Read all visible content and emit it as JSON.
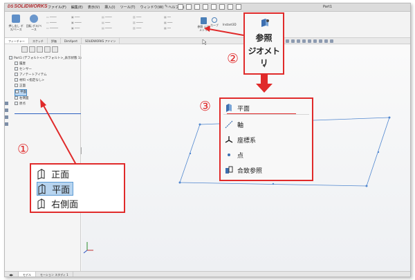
{
  "app": {
    "logo_text": "SOLIDWORKS",
    "logo_mark": "DS",
    "document_title": "Part1",
    "menus": [
      "ファイル(F)",
      "編集(E)",
      "表示(V)",
      "挿入(I)",
      "ツール(T)",
      "ウィンドウ(W)",
      "ヘルプ(H)"
    ]
  },
  "command_manager": {
    "buttons": [
      {
        "label": "押し出し ボス/ベース",
        "icon": "extruded-boss-icon"
      },
      {
        "label": "回転 ボス/ベース",
        "icon": "revolved-boss-icon"
      }
    ],
    "reference_geometry_small_label": "参照 ジオメトリ",
    "curves_label": "カーブ",
    "instant3d_label": "Instant3D",
    "tabs": [
      "フィーチャー",
      "スケッチ",
      "評価",
      "DimXpert",
      "SOLIDWORKS アドイン"
    ]
  },
  "feature_manager": {
    "tree": [
      {
        "label": "Part1 (デフォルト<<デフォルト>_表示状態 1>)",
        "icon": "part-icon"
      },
      {
        "label": "履歴",
        "icon": "history-icon"
      },
      {
        "label": "センサー",
        "icon": "sensor-icon"
      },
      {
        "label": "アノテートアイテム",
        "icon": "annotation-icon"
      },
      {
        "label": "材料 <指定なし>",
        "icon": "material-icon"
      },
      {
        "label": "正面",
        "icon": "plane-icon"
      },
      {
        "label": "平面",
        "icon": "plane-icon"
      },
      {
        "label": "右側面",
        "icon": "plane-icon"
      },
      {
        "label": "原点",
        "icon": "origin-icon"
      }
    ],
    "selected_index": 6
  },
  "bottom_tabs": [
    "モデル",
    "モーション スタディ 1"
  ],
  "callouts": {
    "one": "①",
    "two": "②",
    "three": "③",
    "reference_geometry": {
      "line1": "参照",
      "line2": "ジオメトリ"
    },
    "planes": [
      {
        "label": "正面",
        "selected": false
      },
      {
        "label": "平面",
        "selected": true
      },
      {
        "label": "右側面",
        "selected": false
      }
    ],
    "menu_items": [
      {
        "label": "平面",
        "icon": "plane-icon"
      },
      {
        "label": "軸",
        "icon": "axis-icon"
      },
      {
        "label": "座標系",
        "icon": "coordinate-system-icon"
      },
      {
        "label": "点",
        "icon": "point-icon"
      },
      {
        "label": "合致参照",
        "icon": "mate-reference-icon"
      }
    ]
  },
  "colors": {
    "annotation_red": "#e02a2a",
    "selection_blue": "#b7d4ef",
    "plane_edge_blue": "#4f86cf"
  }
}
